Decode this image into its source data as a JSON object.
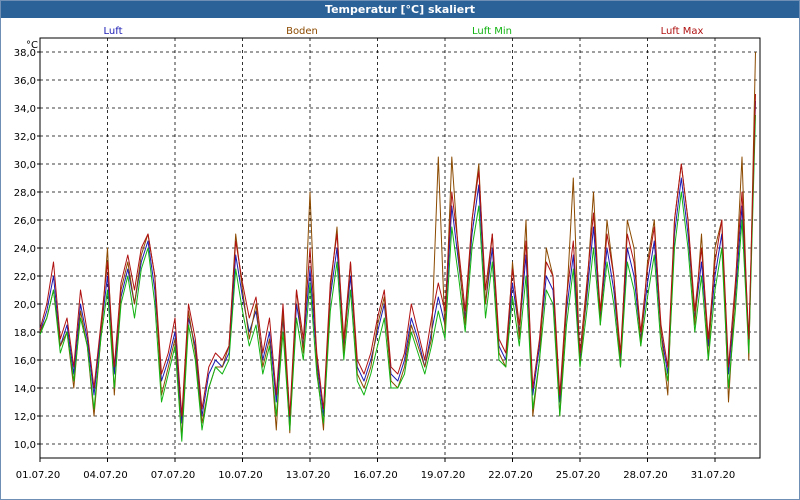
{
  "window": {
    "title": "Temperatur [°C] skaliert"
  },
  "chart_data": {
    "type": "line",
    "title": "Temperatur [°C] skaliert",
    "ylabel": "°C",
    "xlabel": "",
    "ylim": [
      9.0,
      39.0
    ],
    "yticks": [
      "10,0",
      "12,0",
      "14,0",
      "16,0",
      "18,0",
      "20,0",
      "22,0",
      "24,0",
      "26,0",
      "28,0",
      "30,0",
      "32,0",
      "34,0",
      "36,0",
      "38,0"
    ],
    "xticks": [
      {
        "day": 0,
        "label": "01.07.20"
      },
      {
        "day": 3,
        "label": "04.07.20"
      },
      {
        "day": 6,
        "label": "07.07.20"
      },
      {
        "day": 9,
        "label": "10.07.20"
      },
      {
        "day": 12,
        "label": "13.07.20"
      },
      {
        "day": 15,
        "label": "16.07.20"
      },
      {
        "day": 18,
        "label": "19.07.20"
      },
      {
        "day": 21,
        "label": "22.07.20"
      },
      {
        "day": 24,
        "label": "25.07.20"
      },
      {
        "day": 27,
        "label": "28.07.20"
      },
      {
        "day": 30,
        "label": "31.07.20"
      }
    ],
    "xlim_days": [
      0,
      32.0
    ],
    "grid": true,
    "legend_position": "top",
    "series": [
      {
        "name": "Luft",
        "color": "#1a1ab4",
        "x": [
          0,
          0.3,
          0.6,
          0.9,
          1.2,
          1.5,
          1.8,
          2.1,
          2.4,
          2.7,
          3.0,
          3.3,
          3.6,
          3.9,
          4.2,
          4.5,
          4.8,
          5.1,
          5.4,
          5.7,
          6.0,
          6.3,
          6.6,
          6.9,
          7.2,
          7.5,
          7.8,
          8.1,
          8.4,
          8.7,
          9.0,
          9.3,
          9.6,
          9.9,
          10.2,
          10.5,
          10.8,
          11.1,
          11.4,
          11.7,
          12.0,
          12.3,
          12.6,
          12.9,
          13.2,
          13.5,
          13.8,
          14.1,
          14.4,
          14.7,
          15.0,
          15.3,
          15.6,
          15.9,
          16.2,
          16.5,
          16.8,
          17.1,
          17.4,
          17.7,
          18.0,
          18.3,
          18.6,
          18.9,
          19.2,
          19.5,
          19.8,
          20.1,
          20.4,
          20.7,
          21.0,
          21.3,
          21.6,
          21.9,
          22.2,
          22.5,
          22.8,
          23.1,
          23.4,
          23.7,
          24.0,
          24.3,
          24.6,
          24.9,
          25.2,
          25.5,
          25.8,
          26.1,
          26.4,
          26.7,
          27.0,
          27.3,
          27.6,
          27.9,
          28.2,
          28.5,
          28.8,
          29.1,
          29.4,
          29.7,
          30.0,
          30.3,
          30.6,
          30.9,
          31.2,
          31.5,
          31.8
        ],
        "y": [
          18.0,
          19.5,
          22.0,
          17.0,
          18.5,
          15.0,
          20.0,
          17.5,
          13.5,
          18.0,
          22.0,
          15.0,
          20.5,
          22.5,
          20.0,
          23.0,
          24.5,
          21.0,
          14.5,
          16.0,
          18.0,
          11.5,
          19.0,
          17.0,
          12.0,
          15.0,
          16.0,
          15.5,
          16.5,
          23.5,
          20.5,
          18.0,
          19.5,
          16.0,
          18.0,
          13.0,
          19.0,
          11.5,
          20.0,
          17.0,
          22.5,
          16.0,
          12.0,
          20.5,
          24.0,
          17.0,
          22.0,
          15.5,
          14.5,
          16.0,
          18.0,
          20.0,
          15.0,
          14.5,
          16.0,
          19.0,
          17.5,
          15.5,
          18.0,
          20.5,
          18.5,
          27.0,
          23.0,
          19.0,
          25.0,
          28.5,
          20.0,
          24.0,
          17.0,
          16.0,
          21.5,
          18.0,
          23.5,
          13.5,
          17.0,
          22.0,
          21.0,
          13.0,
          19.5,
          23.5,
          16.0,
          20.5,
          25.5,
          19.0,
          24.0,
          21.0,
          16.0,
          24.0,
          22.0,
          17.5,
          21.5,
          24.5,
          18.0,
          15.0,
          25.0,
          29.0,
          25.0,
          19.0,
          23.0,
          17.0,
          22.0,
          25.0,
          15.0,
          20.5,
          27.0,
          17.0,
          34.5
        ]
      },
      {
        "name": "Boden",
        "color": "#8b4a00",
        "x": [
          0,
          0.3,
          0.6,
          0.9,
          1.2,
          1.5,
          1.8,
          2.1,
          2.4,
          2.7,
          3.0,
          3.3,
          3.6,
          3.9,
          4.2,
          4.5,
          4.8,
          5.1,
          5.4,
          5.7,
          6.0,
          6.3,
          6.6,
          6.9,
          7.2,
          7.5,
          7.8,
          8.1,
          8.4,
          8.7,
          9.0,
          9.3,
          9.6,
          9.9,
          10.2,
          10.5,
          10.8,
          11.1,
          11.4,
          11.7,
          12.0,
          12.3,
          12.6,
          12.9,
          13.2,
          13.5,
          13.8,
          14.1,
          14.4,
          14.7,
          15.0,
          15.3,
          15.6,
          15.9,
          16.2,
          16.5,
          16.8,
          17.1,
          17.4,
          17.7,
          18.0,
          18.3,
          18.6,
          18.9,
          19.2,
          19.5,
          19.8,
          20.1,
          20.4,
          20.7,
          21.0,
          21.3,
          21.6,
          21.9,
          22.2,
          22.5,
          22.8,
          23.1,
          23.4,
          23.7,
          24.0,
          24.3,
          24.6,
          24.9,
          25.2,
          25.5,
          25.8,
          26.1,
          26.4,
          26.7,
          27.0,
          27.3,
          27.6,
          27.9,
          28.2,
          28.5,
          28.8,
          29.1,
          29.4,
          29.7,
          30.0,
          30.3,
          30.6,
          30.9,
          31.2,
          31.5,
          31.8
        ],
        "y": [
          18.0,
          19.0,
          21.0,
          17.0,
          18.0,
          14.0,
          19.5,
          17.0,
          12.0,
          17.5,
          24.0,
          13.5,
          21.0,
          23.0,
          20.0,
          23.5,
          25.0,
          22.0,
          13.5,
          15.5,
          17.5,
          10.5,
          19.5,
          16.5,
          11.5,
          14.0,
          15.5,
          15.5,
          17.0,
          25.0,
          21.0,
          17.5,
          20.0,
          15.5,
          17.5,
          11.0,
          19.5,
          10.8,
          21.0,
          16.5,
          28.0,
          15.5,
          11.0,
          21.0,
          25.5,
          16.5,
          23.0,
          15.0,
          14.0,
          15.5,
          18.5,
          20.5,
          14.5,
          14.0,
          15.5,
          18.5,
          17.0,
          15.5,
          17.5,
          30.5,
          18.0,
          30.5,
          23.5,
          18.5,
          26.0,
          30.0,
          20.0,
          25.0,
          16.5,
          15.5,
          23.0,
          17.5,
          26.0,
          12.0,
          16.0,
          24.0,
          22.0,
          12.0,
          20.0,
          29.0,
          15.5,
          21.0,
          28.0,
          18.5,
          26.0,
          22.0,
          15.5,
          26.0,
          24.0,
          17.0,
          23.0,
          26.0,
          18.0,
          13.5,
          26.0,
          30.0,
          26.0,
          18.5,
          25.0,
          16.0,
          24.0,
          26.0,
          13.0,
          21.0,
          30.5,
          16.0,
          38.0
        ]
      },
      {
        "name": "Luft Min",
        "color": "#12b312",
        "x": [
          0,
          0.3,
          0.6,
          0.9,
          1.2,
          1.5,
          1.8,
          2.1,
          2.4,
          2.7,
          3.0,
          3.3,
          3.6,
          3.9,
          4.2,
          4.5,
          4.8,
          5.1,
          5.4,
          5.7,
          6.0,
          6.3,
          6.6,
          6.9,
          7.2,
          7.5,
          7.8,
          8.1,
          8.4,
          8.7,
          9.0,
          9.3,
          9.6,
          9.9,
          10.2,
          10.5,
          10.8,
          11.1,
          11.4,
          11.7,
          12.0,
          12.3,
          12.6,
          12.9,
          13.2,
          13.5,
          13.8,
          14.1,
          14.4,
          14.7,
          15.0,
          15.3,
          15.6,
          15.9,
          16.2,
          16.5,
          16.8,
          17.1,
          17.4,
          17.7,
          18.0,
          18.3,
          18.6,
          18.9,
          19.2,
          19.5,
          19.8,
          20.1,
          20.4,
          20.7,
          21.0,
          21.3,
          21.6,
          21.9,
          22.2,
          22.5,
          22.8,
          23.1,
          23.4,
          23.7,
          24.0,
          24.3,
          24.6,
          24.9,
          25.2,
          25.5,
          25.8,
          26.1,
          26.4,
          26.7,
          27.0,
          27.3,
          27.6,
          27.9,
          28.2,
          28.5,
          28.8,
          29.1,
          29.4,
          29.7,
          30.0,
          30.3,
          30.6,
          30.9,
          31.2,
          31.5,
          31.8
        ],
        "y": [
          17.8,
          19.0,
          21.0,
          16.5,
          18.0,
          14.5,
          19.0,
          17.0,
          12.5,
          17.5,
          21.0,
          14.0,
          20.0,
          22.0,
          19.0,
          22.5,
          24.0,
          20.0,
          13.0,
          15.0,
          17.0,
          10.2,
          18.5,
          16.0,
          11.0,
          14.0,
          15.5,
          15.0,
          16.0,
          22.5,
          19.5,
          17.0,
          18.5,
          15.0,
          17.0,
          12.0,
          18.0,
          11.0,
          19.0,
          16.0,
          21.5,
          15.0,
          11.5,
          19.5,
          23.0,
          16.0,
          21.0,
          14.5,
          13.5,
          15.0,
          17.0,
          19.0,
          14.0,
          14.0,
          15.0,
          18.0,
          16.5,
          15.0,
          17.0,
          19.5,
          17.5,
          25.5,
          22.0,
          18.0,
          24.0,
          27.0,
          19.0,
          23.0,
          16.0,
          15.5,
          20.5,
          17.0,
          22.0,
          12.5,
          16.0,
          21.0,
          20.0,
          12.0,
          18.5,
          22.5,
          15.5,
          19.5,
          24.0,
          18.5,
          23.0,
          20.0,
          15.5,
          23.0,
          21.0,
          17.0,
          20.5,
          23.5,
          17.0,
          14.5,
          24.0,
          28.0,
          24.0,
          18.0,
          22.0,
          16.0,
          21.0,
          24.0,
          14.0,
          19.5,
          26.0,
          16.5,
          33.5
        ]
      },
      {
        "name": "Luft Max",
        "color": "#b01212",
        "x": [
          0,
          0.3,
          0.6,
          0.9,
          1.2,
          1.5,
          1.8,
          2.1,
          2.4,
          2.7,
          3.0,
          3.3,
          3.6,
          3.9,
          4.2,
          4.5,
          4.8,
          5.1,
          5.4,
          5.7,
          6.0,
          6.3,
          6.6,
          6.9,
          7.2,
          7.5,
          7.8,
          8.1,
          8.4,
          8.7,
          9.0,
          9.3,
          9.6,
          9.9,
          10.2,
          10.5,
          10.8,
          11.1,
          11.4,
          11.7,
          12.0,
          12.3,
          12.6,
          12.9,
          13.2,
          13.5,
          13.8,
          14.1,
          14.4,
          14.7,
          15.0,
          15.3,
          15.6,
          15.9,
          16.2,
          16.5,
          16.8,
          17.1,
          17.4,
          17.7,
          18.0,
          18.3,
          18.6,
          18.9,
          19.2,
          19.5,
          19.8,
          20.1,
          20.4,
          20.7,
          21.0,
          21.3,
          21.6,
          21.9,
          22.2,
          22.5,
          22.8,
          23.1,
          23.4,
          23.7,
          24.0,
          24.3,
          24.6,
          24.9,
          25.2,
          25.5,
          25.8,
          26.1,
          26.4,
          26.7,
          27.0,
          27.3,
          27.6,
          27.9,
          28.2,
          28.5,
          28.8,
          29.1,
          29.4,
          29.7,
          30.0,
          30.3,
          30.6,
          30.9,
          31.2,
          31.5,
          31.8
        ],
        "y": [
          18.2,
          20.0,
          23.0,
          17.5,
          19.0,
          15.5,
          21.0,
          18.0,
          14.0,
          18.5,
          23.0,
          15.5,
          21.5,
          23.5,
          21.0,
          24.0,
          25.0,
          22.0,
          15.0,
          16.5,
          19.0,
          12.0,
          20.0,
          17.5,
          12.5,
          15.5,
          16.5,
          16.0,
          17.0,
          24.5,
          21.5,
          19.0,
          20.5,
          16.5,
          19.0,
          13.5,
          20.0,
          12.0,
          21.0,
          17.5,
          24.0,
          16.5,
          12.5,
          21.5,
          25.0,
          17.5,
          23.0,
          16.0,
          15.0,
          16.5,
          19.0,
          21.0,
          15.5,
          15.0,
          16.5,
          20.0,
          18.0,
          16.0,
          19.0,
          21.5,
          19.5,
          28.0,
          24.0,
          19.5,
          26.0,
          29.5,
          21.0,
          25.0,
          17.5,
          16.5,
          22.5,
          18.5,
          24.5,
          14.0,
          17.5,
          23.0,
          22.0,
          13.5,
          20.5,
          24.5,
          16.5,
          21.5,
          26.5,
          19.5,
          25.0,
          22.0,
          16.5,
          25.0,
          23.0,
          18.0,
          22.5,
          25.5,
          18.5,
          15.5,
          26.0,
          30.0,
          26.0,
          19.5,
          24.0,
          17.5,
          23.0,
          26.0,
          15.5,
          21.5,
          28.0,
          17.5,
          35.0
        ]
      }
    ]
  }
}
